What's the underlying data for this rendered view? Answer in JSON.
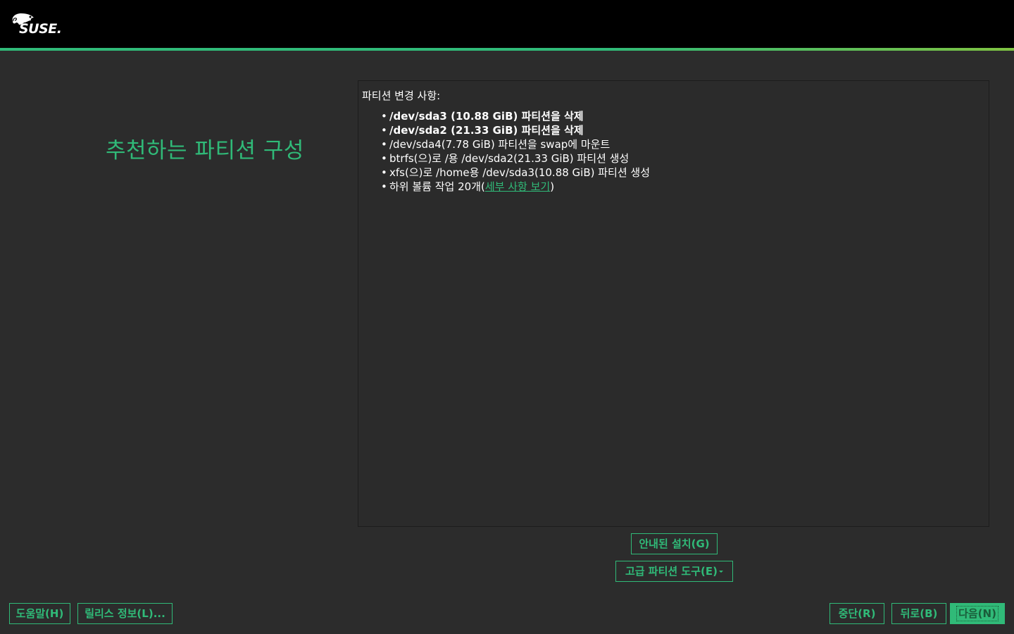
{
  "header": {
    "logo_text": "SUSE."
  },
  "page_title": "추천하는 파티션 구성",
  "changes": {
    "heading": "파티션 변경 사항:",
    "items": [
      {
        "text": "/dev/sda3 (10.88 GiB) 파티션을 삭제",
        "bold": true
      },
      {
        "text": "/dev/sda2 (21.33 GiB) 파티션을 삭제",
        "bold": true
      },
      {
        "text": "/dev/sda4(7.78 GiB) 파티션을 swap에 마운트",
        "bold": false
      },
      {
        "text": "btrfs(으)로 /용 /dev/sda2(21.33 GiB) 파티션 생성",
        "bold": false
      },
      {
        "text": "xfs(으)로 /home용 /dev/sda3(10.88 GiB) 파티션 생성",
        "bold": false
      }
    ],
    "subvolume_prefix": "하위 볼륨 작업 20개(",
    "subvolume_link": "세부 사항 보기",
    "subvolume_suffix": ")"
  },
  "buttons": {
    "guided_setup": "안내된 설치(G)",
    "expert_partitioner": "고급 파티션 도구(E)",
    "help": "도움말(H)",
    "release_notes": "릴리스 정보(L)...",
    "abort": "중단(R)",
    "back": "뒤로(B)",
    "next": "다음(N)"
  },
  "colors": {
    "accent": "#30ba78",
    "background": "#2c2c2c",
    "header": "#000000"
  }
}
